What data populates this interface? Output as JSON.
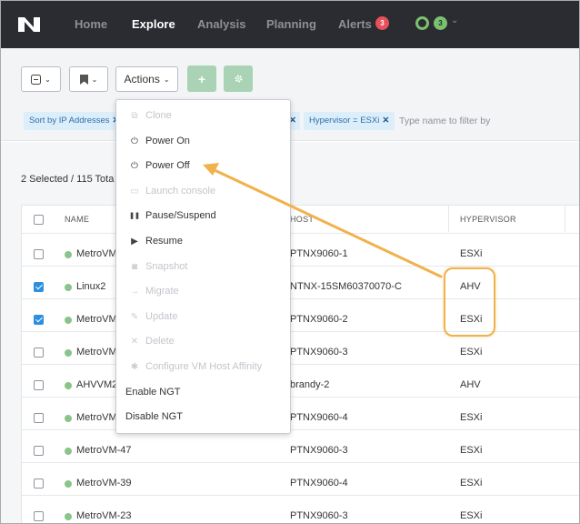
{
  "nav": {
    "items": [
      {
        "label": "Home",
        "active": false
      },
      {
        "label": "Explore",
        "active": true
      },
      {
        "label": "Analysis",
        "active": false
      },
      {
        "label": "Planning",
        "active": false
      },
      {
        "label": "Alerts",
        "active": false
      }
    ],
    "alerts_count": "3",
    "health_count": "3"
  },
  "toolbar": {
    "actions_label": "Actions",
    "add_icon": "plus-icon",
    "settings_icon": "gear-icon"
  },
  "filters": {
    "chips": [
      {
        "label": "Sort by IP Addresses"
      },
      {
        "label": ""
      },
      {
        "label": "Hypervisor = ESXi"
      }
    ],
    "placeholder": "Type name to filter by"
  },
  "selection": {
    "selected": "2 Selected",
    "total": "/ 115 Tota"
  },
  "table": {
    "headers": [
      "NAME",
      "HOST",
      "HYPERVISOR"
    ],
    "rows": [
      {
        "name": "MetroVM",
        "host": "PTNX9060-1",
        "hypervisor": "ESXi",
        "checked": false
      },
      {
        "name": "Linux2",
        "host": "NTNX-15SM60370070-C",
        "hypervisor": "AHV",
        "checked": true
      },
      {
        "name": "MetroVM",
        "host": "PTNX9060-2",
        "hypervisor": "ESXi",
        "checked": true
      },
      {
        "name": "MetroVM",
        "host": "PTNX9060-3",
        "hypervisor": "ESXi",
        "checked": false
      },
      {
        "name": "AHVVM2",
        "host": "brandy-2",
        "hypervisor": "AHV",
        "checked": false
      },
      {
        "name": "MetroVM",
        "host": "PTNX9060-4",
        "hypervisor": "ESXi",
        "checked": false
      },
      {
        "name": "MetroVM-47",
        "host": "PTNX9060-3",
        "hypervisor": "ESXi",
        "checked": false
      },
      {
        "name": "MetroVM-39",
        "host": "PTNX9060-4",
        "hypervisor": "ESXi",
        "checked": false
      },
      {
        "name": "MetroVM-23",
        "host": "PTNX9060-3",
        "hypervisor": "ESXi",
        "checked": false
      }
    ]
  },
  "menu": {
    "items": [
      {
        "label": "Clone",
        "icon": "clone-icon",
        "enabled": false
      },
      {
        "label": "Power On",
        "icon": "power-icon",
        "enabled": true
      },
      {
        "label": "Power Off",
        "icon": "power-icon",
        "enabled": true
      },
      {
        "label": "Launch console",
        "icon": "console-icon",
        "enabled": false
      },
      {
        "label": "Pause/Suspend",
        "icon": "pause-icon",
        "enabled": true
      },
      {
        "label": "Resume",
        "icon": "play-icon",
        "enabled": true
      },
      {
        "label": "Snapshot",
        "icon": "camera-icon",
        "enabled": false
      },
      {
        "label": "Migrate",
        "icon": "arrow-right-icon",
        "enabled": false
      },
      {
        "label": "Update",
        "icon": "pencil-icon",
        "enabled": false
      },
      {
        "label": "Delete",
        "icon": "x-icon",
        "enabled": false
      },
      {
        "label": "Configure VM Host Affinity",
        "icon": "gear-icon",
        "enabled": false
      },
      {
        "label": "Enable NGT",
        "icon": "",
        "enabled": true
      },
      {
        "label": "Disable NGT",
        "icon": "",
        "enabled": true
      }
    ]
  },
  "colors": {
    "nav_bg": "#2b2c31",
    "accent_green": "#7bc26f",
    "checkbox_blue": "#2d8fe0",
    "annotation_orange": "#f0b24a",
    "alert_red": "#e8505b"
  }
}
